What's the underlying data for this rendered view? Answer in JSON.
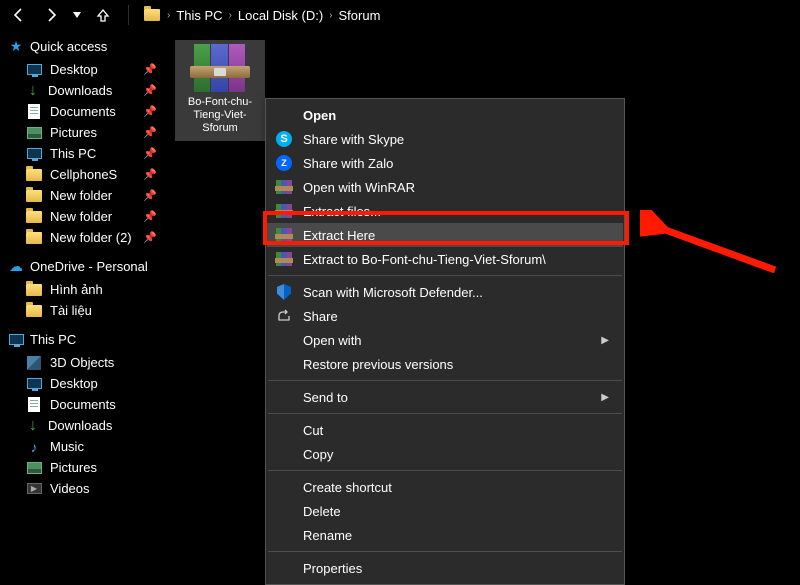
{
  "breadcrumbs": {
    "item0": "This PC",
    "item1": "Local Disk (D:)",
    "item2": "Sforum"
  },
  "sidebar": {
    "quick_access": "Quick access",
    "qa": {
      "desktop": "Desktop",
      "downloads": "Downloads",
      "documents": "Documents",
      "pictures": "Pictures",
      "thispc": "This PC",
      "cellphones": "CellphoneS",
      "newfolder": "New folder",
      "newfolder_b": "New folder",
      "newfolder2": "New folder (2)"
    },
    "onedrive": "OneDrive - Personal",
    "od": {
      "hinhanh": "Hình ảnh",
      "tailieu": "Tài liệu"
    },
    "thispc": "This PC",
    "pc": {
      "objects3d": "3D Objects",
      "desktop": "Desktop",
      "documents": "Documents",
      "downloads": "Downloads",
      "music": "Music",
      "pictures": "Pictures",
      "videos": "Videos"
    }
  },
  "file": {
    "name": "Bo-Font-chu-Tieng-Viet-Sforum"
  },
  "menu": {
    "open": "Open",
    "skype": "Share with Skype",
    "zalo": "Share with Zalo",
    "open_winrar": "Open with WinRAR",
    "extract_files": "Extract files...",
    "extract_here": "Extract Here",
    "extract_to": "Extract to Bo-Font-chu-Tieng-Viet-Sforum\\",
    "defender": "Scan with Microsoft Defender...",
    "share": "Share",
    "open_with": "Open with",
    "restore": "Restore previous versions",
    "send_to": "Send to",
    "cut": "Cut",
    "copy": "Copy",
    "shortcut": "Create shortcut",
    "delete": "Delete",
    "rename": "Rename",
    "properties": "Properties"
  },
  "highlight": {
    "target": "extract_here"
  }
}
